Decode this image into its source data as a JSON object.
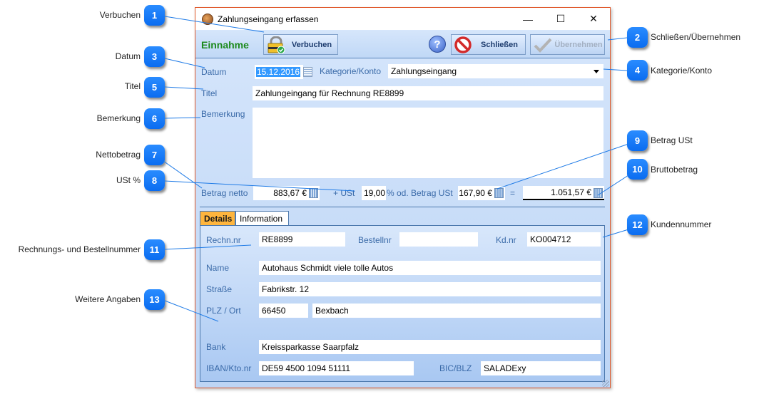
{
  "window": {
    "title": "Zahlungseingang erfassen",
    "controls": {
      "minimize": "—",
      "maximize": "☐",
      "close": "✕"
    }
  },
  "toolbar": {
    "mode_label": "Einnahme",
    "book_label": "Verbuchen",
    "help_label": "?",
    "close_label": "Schließen",
    "apply_label": "Übernehmen"
  },
  "form": {
    "date_label": "Datum",
    "date_value": "15.12.2016",
    "category_label": "Kategorie/Konto",
    "category_value": "Zahlungseingang",
    "title_label": "Titel",
    "title_value": "Zahlungeingang für Rechnung RE8899",
    "remark_label": "Bemerkung",
    "remark_value": "",
    "net_label": "Betrag netto",
    "net_value": "883,67 €",
    "vat_plus_label": "+ USt",
    "vat_percent_value": "19,00",
    "vat_amount_label": "% od. Betrag USt",
    "vat_amount_value": "167,90 €",
    "equals_label": "=",
    "gross_value": "1.051,57 €"
  },
  "tabs": [
    {
      "label": "Details",
      "active": true
    },
    {
      "label": "Information",
      "active": false
    }
  ],
  "details": {
    "invoice_label": "Rechn.nr",
    "invoice_value": "RE8899",
    "order_label": "Bestellnr",
    "order_value": "",
    "customer_label": "Kd.nr",
    "customer_value": "KO004712",
    "name_label": "Name",
    "name_value": "Autohaus Schmidt viele tolle Autos",
    "street_label": "Straße",
    "street_value": "Fabrikstr. 12",
    "city_label": "PLZ / Ort",
    "zip_value": "66450",
    "city_value": "Bexbach",
    "bank_label": "Bank",
    "bank_value": "Kreissparkasse Saarpfalz",
    "iban_label": "IBAN/Kto.nr",
    "iban_value": "DE59 4500 1094 51111",
    "bic_label": "BIC/BLZ",
    "bic_value": "SALADExy"
  },
  "callouts": [
    {
      "num": "1",
      "label": "Verbuchen"
    },
    {
      "num": "2",
      "label": "Schließen/Übernehmen"
    },
    {
      "num": "3",
      "label": "Datum"
    },
    {
      "num": "4",
      "label": "Kategorie/Konto"
    },
    {
      "num": "5",
      "label": "Titel"
    },
    {
      "num": "6",
      "label": "Bemerkung"
    },
    {
      "num": "7",
      "label": "Nettobetrag"
    },
    {
      "num": "8",
      "label": "USt %"
    },
    {
      "num": "9",
      "label": "Betrag USt"
    },
    {
      "num": "10",
      "label": "Bruttobetrag"
    },
    {
      "num": "11",
      "label": "Rechnungs- und Bestellnummer"
    },
    {
      "num": "12",
      "label": "Kundennummer"
    },
    {
      "num": "13",
      "label": "Weitere Angaben"
    }
  ],
  "colors": {
    "accent_badge": "#0a6cf0",
    "window_border": "#e0582a",
    "mode_label": "#1d8a1d",
    "active_tab": "#ffb53d",
    "field_label": "#3a6aa8"
  }
}
